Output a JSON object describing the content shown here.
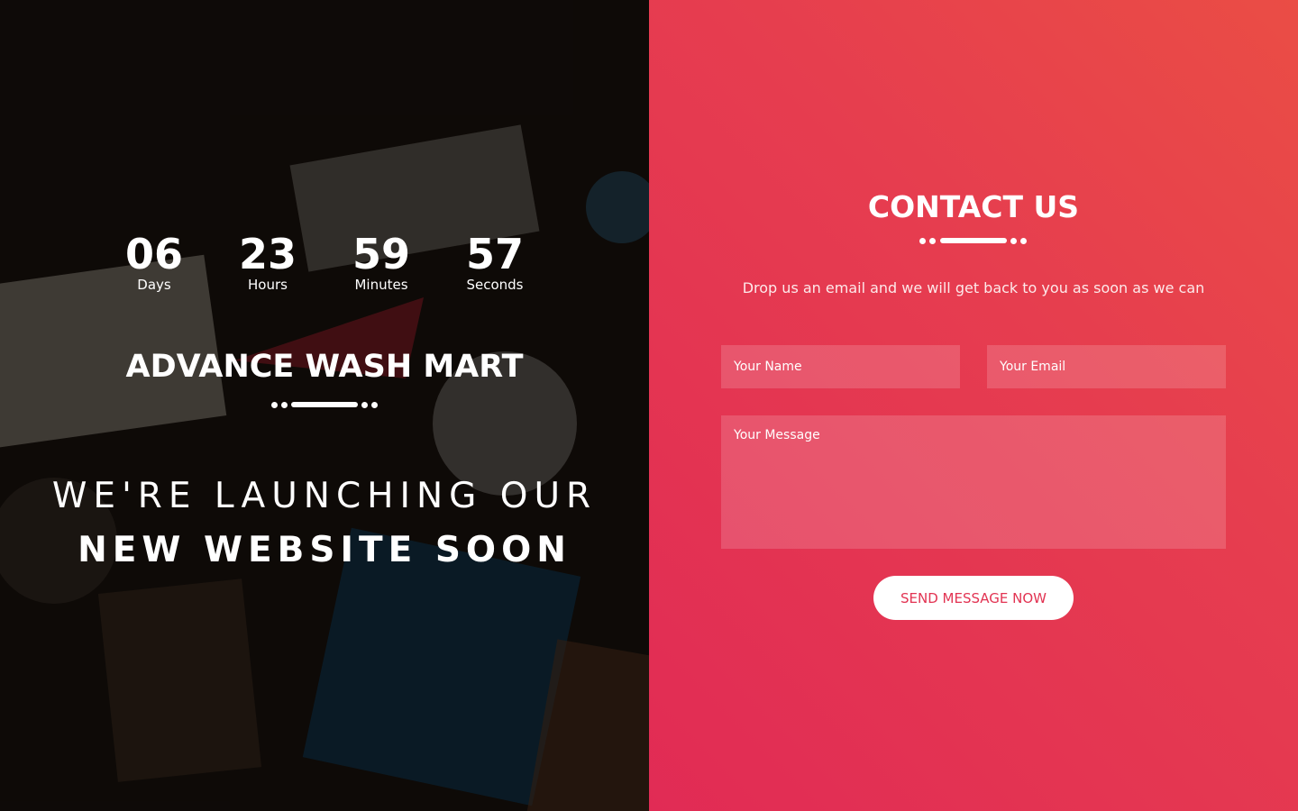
{
  "countdown": {
    "days": {
      "value": "06",
      "label": "Days"
    },
    "hours": {
      "value": "23",
      "label": "Hours"
    },
    "minutes": {
      "value": "59",
      "label": "Minutes"
    },
    "seconds": {
      "value": "57",
      "label": "Seconds"
    }
  },
  "brand": {
    "name": "ADVANCE WASH MART"
  },
  "launch": {
    "line1": "WE'RE LAUNCHING OUR",
    "line2": "NEW WEBSITE SOON"
  },
  "contact": {
    "title": "CONTACT US",
    "subtitle": "Drop us an email and we will get back to you as soon as we can",
    "name_placeholder": "Your Name",
    "email_placeholder": "Your Email",
    "message_placeholder": "Your Message",
    "send_label": "SEND MESSAGE NOW"
  },
  "colors": {
    "accent": "#e23352",
    "right_gradient_start": "#ea4d45",
    "right_gradient_end": "#e12b55"
  }
}
